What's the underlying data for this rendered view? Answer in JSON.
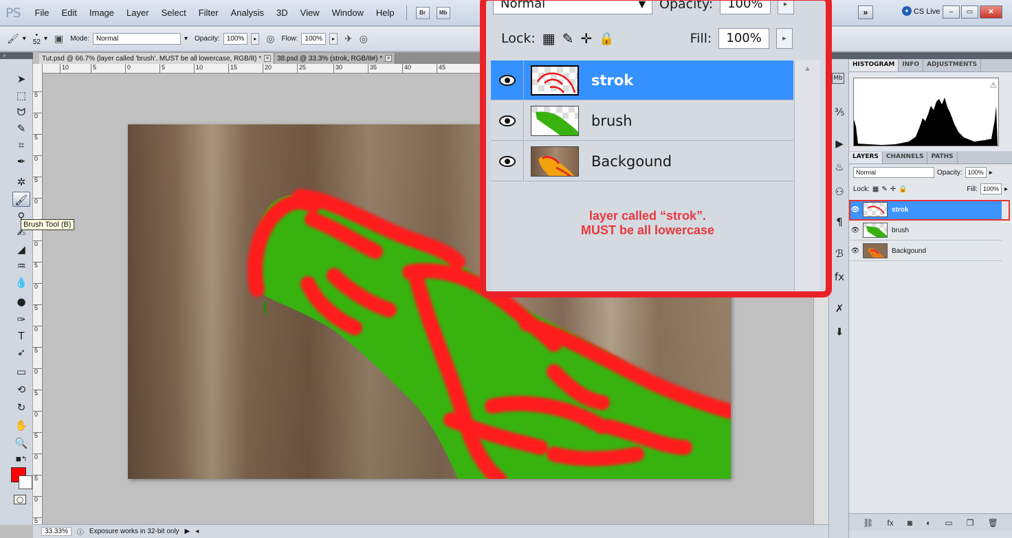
{
  "menubar": {
    "logo": "PS",
    "items": [
      "File",
      "Edit",
      "Image",
      "Layer",
      "Select",
      "Filter",
      "Analysis",
      "3D",
      "View",
      "Window",
      "Help"
    ],
    "bridge_label": "Br",
    "minibridge_label": "Mb",
    "extend_label": "»",
    "cslive_label": "CS Live ▾",
    "window_buttons": [
      "–",
      "▭",
      "✕"
    ]
  },
  "options": {
    "brush_size": "52",
    "mode_label": "Mode:",
    "mode_value": "Normal",
    "opacity_label": "Opacity:",
    "opacity_value": "100%",
    "flow_label": "Flow:",
    "flow_value": "100%"
  },
  "document_tabs": [
    {
      "title": "Tut.psd @ 66.7% (layer called 'brush'. MUST be all lowercase, RGB/8) *",
      "active": true
    },
    {
      "title": "38.psd @ 33.3% (strok, RGB/8#) *",
      "active": false
    }
  ],
  "rulers": {
    "top": [
      "10",
      "5",
      "0",
      "5",
      "10",
      "15",
      "20",
      "25",
      "30",
      "35",
      "40",
      "45"
    ],
    "left": [
      "5",
      "0",
      "5",
      "0",
      "5",
      "0",
      "5",
      "0",
      "5",
      "0",
      "5",
      "0",
      "5",
      "0",
      "5",
      "0",
      "5",
      "0",
      "5",
      "0",
      "5"
    ]
  },
  "tooltip": "Brush Tool (B)",
  "colors": {
    "foreground": "#ff0000",
    "background": "#ffffff",
    "callout_border": "#ea2228",
    "selection": "#3591ff"
  },
  "statusbar": {
    "zoom": "33.33%",
    "info": "Exposure works in 32-bit only"
  },
  "callout": {
    "blend_mode": "Normal",
    "opacity_label": "Opacity:",
    "opacity_value": "100%",
    "lock_label": "Lock:",
    "fill_label": "Fill:",
    "fill_value": "100%",
    "layers": [
      {
        "name": "strok",
        "selected": true,
        "thumb": "strok"
      },
      {
        "name": "brush",
        "selected": false,
        "thumb": "brush"
      },
      {
        "name": "Backgound",
        "selected": false,
        "thumb": "background"
      }
    ],
    "note_line1": "layer called “strok”.",
    "note_line2": "MUST be all lowercase"
  },
  "right_panel": {
    "top_tabs": [
      "HISTOGRAM",
      "INFO",
      "ADJUSTMENTS"
    ],
    "layer_tabs": [
      "LAYERS",
      "CHANNELS",
      "PATHS"
    ],
    "blend_mode": "Normal",
    "opacity_label": "Opacity:",
    "opacity_value": "100%",
    "lock_label": "Lock:",
    "fill_label": "Fill:",
    "fill_value": "100%",
    "layers": [
      {
        "name": "strok",
        "selected": true
      },
      {
        "name": "brush",
        "selected": false
      },
      {
        "name": "Backgound",
        "selected": false
      }
    ],
    "footer_icons": [
      "link-icon",
      "fx-icon",
      "mask-icon",
      "adjustment-icon",
      "group-icon",
      "new-layer-icon",
      "trash-icon"
    ]
  }
}
